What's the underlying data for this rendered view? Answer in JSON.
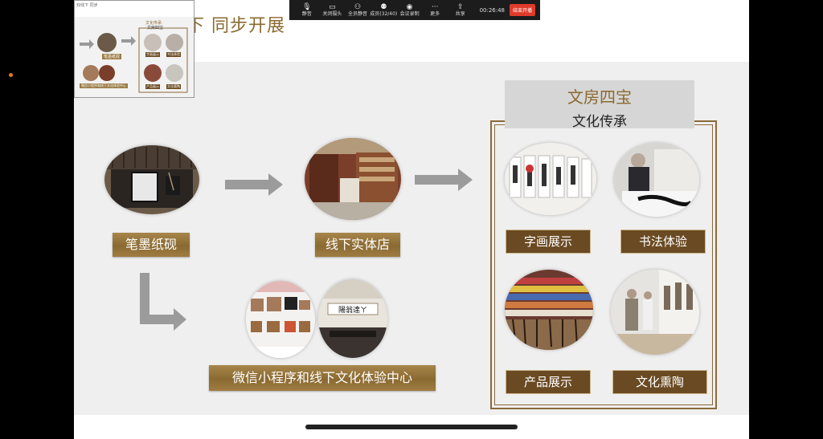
{
  "slide": {
    "title_partial": "下 同步开展",
    "top_left_label": "笔墨纸砚",
    "store_label": "线下实体店",
    "bottom_label": "微信小程序和线下文化体验中心",
    "stack_title_1": "文房四宝",
    "stack_title_2": "文化传承",
    "tile_1": "字画展示",
    "tile_2": "书法体验",
    "tile_3": "产品展示",
    "tile_4": "文化熏陶",
    "calligraphy_board_text": "陽翁達ㄚ"
  },
  "toolbar": {
    "items": [
      {
        "icon": "microphone-icon",
        "label": "静音"
      },
      {
        "icon": "camera-icon",
        "label": "关闭摄头"
      },
      {
        "icon": "mute-all-icon",
        "label": "全员静音"
      },
      {
        "icon": "members-icon",
        "label": "成员(32/40)"
      },
      {
        "icon": "record-icon",
        "label": "会议录制"
      },
      {
        "icon": "more-icon",
        "label": "更多"
      },
      {
        "icon": "share-icon",
        "label": "共享"
      }
    ],
    "timer": "00:26:48",
    "end_label": "结束开播"
  },
  "thumbnail": {
    "label": "双线下 同步",
    "center_line1": "文化传承",
    "center_line2": "文房四宝",
    "caption_left": "笔墨纸砚",
    "caption_bottom": "微信小程序和线下文化体验中心",
    "tiles": [
      "字画展示",
      "书法体验",
      "产品展示",
      "文化熏陶"
    ]
  }
}
